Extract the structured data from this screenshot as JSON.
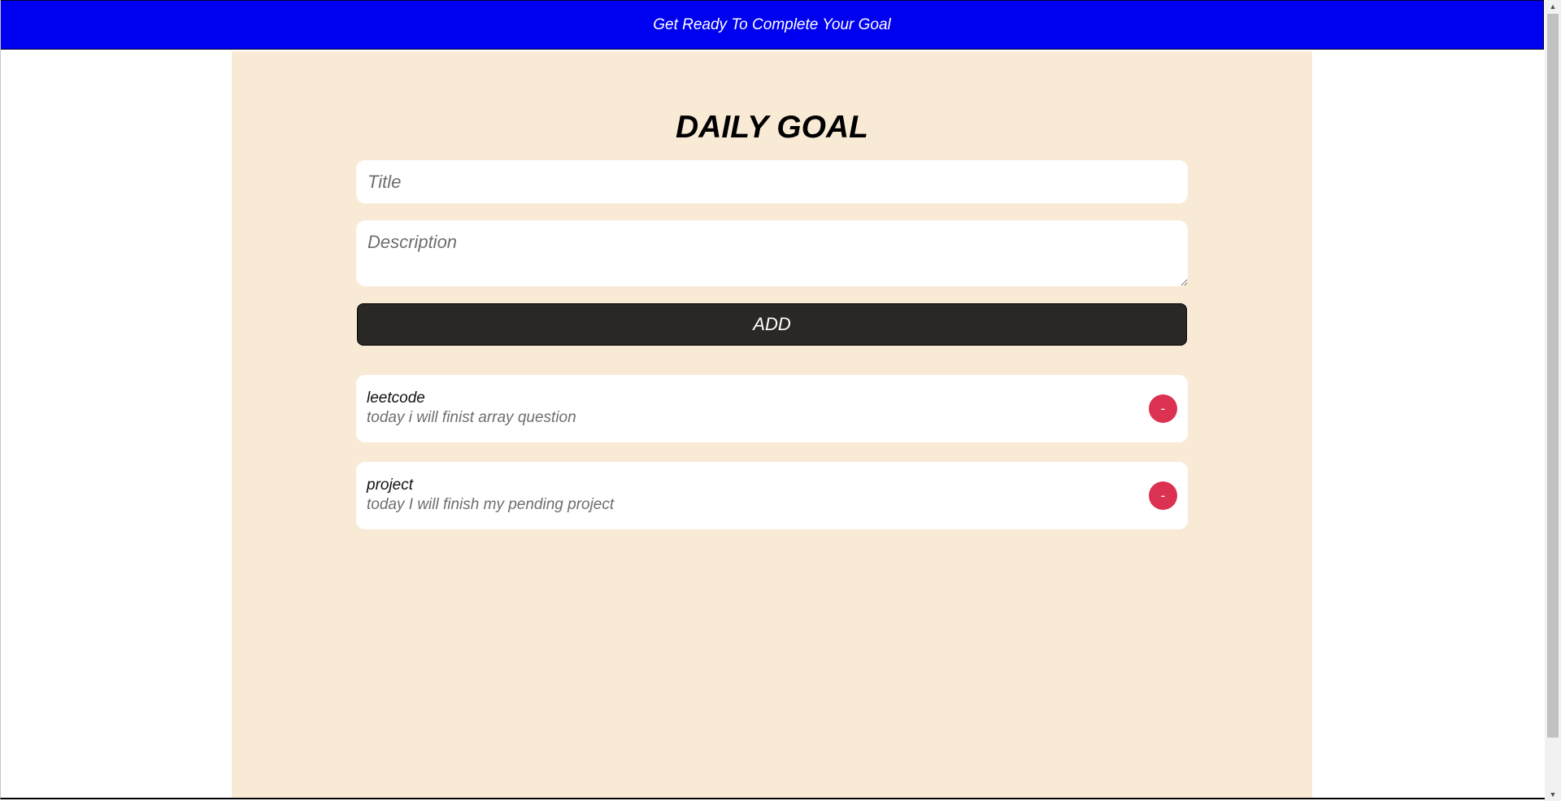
{
  "header": {
    "banner_text": "Get Ready To Complete Your Goal",
    "banner_color": "#0000f0"
  },
  "main": {
    "heading": "DAILY GOAL",
    "panel_color": "#f9ead6",
    "form": {
      "title_value": "",
      "title_placeholder": "Title",
      "description_value": "",
      "description_placeholder": "Description",
      "add_label": "ADD"
    },
    "goals": [
      {
        "title": "leetcode",
        "description": "today i will finist array question",
        "remove_label": "-"
      },
      {
        "title": "project",
        "description": "today I will finish my pending project",
        "remove_label": "-"
      }
    ],
    "remove_button_color": "#dc3252"
  },
  "scrollbar": {
    "up_icon": "triangle-up-icon",
    "down_icon": "triangle-down-icon"
  }
}
